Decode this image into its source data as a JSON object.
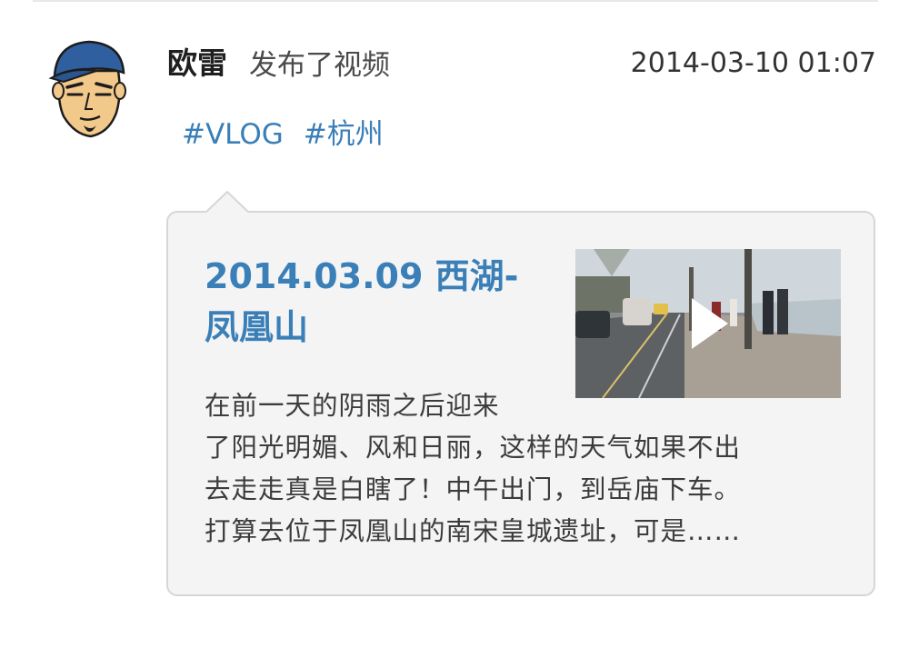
{
  "post": {
    "author": "欧雷",
    "action": "发布了视频",
    "timestamp": "2014-03-10 01:07",
    "tags": [
      "#VLOG",
      "#杭州"
    ]
  },
  "card": {
    "title": "2014.03.09 西湖-凤凰山",
    "description_lines": [
      "在前一天的阴雨之后迎来",
      "了阳光明媚、风和日丽，这样的天气如果不出",
      "去走走真是白瞎了！中午出门，到岳庙下车。",
      "打算去位于凤凰山的南宋皇城遗址，可是……"
    ],
    "thumbnail_icon": "play-icon"
  },
  "colors": {
    "accent": "#3a7fb8",
    "card_bg": "#f4f4f4",
    "card_border": "#d6d6d6"
  }
}
